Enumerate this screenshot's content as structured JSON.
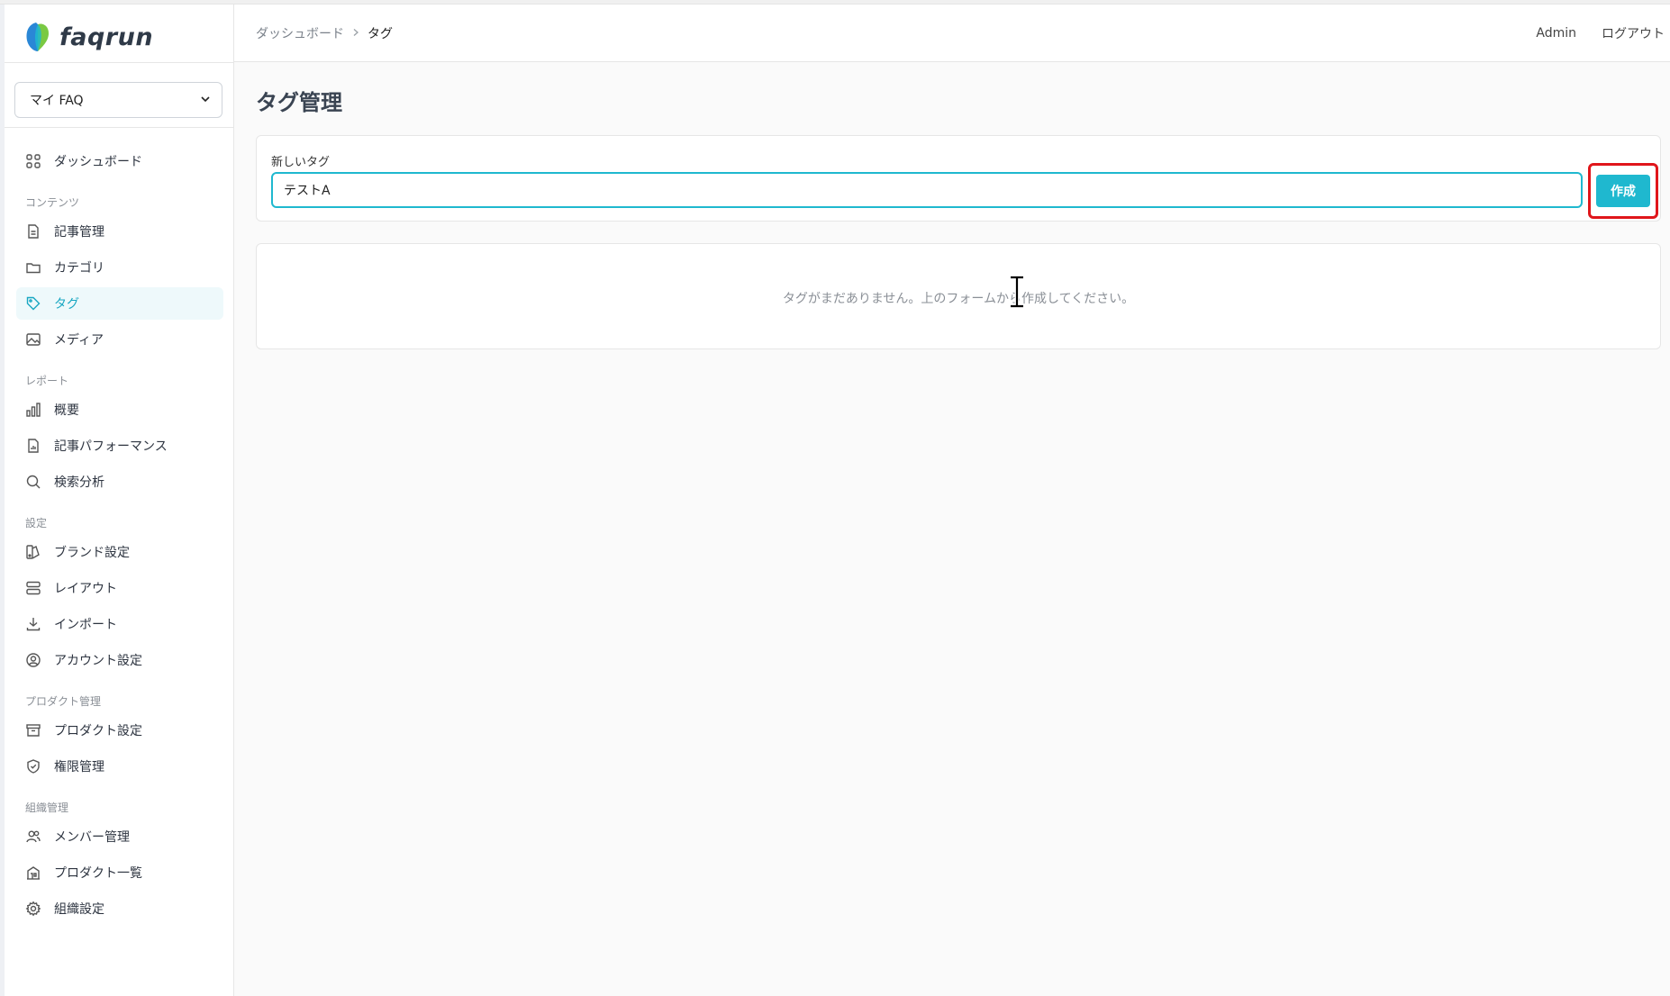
{
  "brand": {
    "name": "faqrun",
    "accent": "#1fb8cf",
    "highlight": "#e0161b"
  },
  "sidebar": {
    "product_select": {
      "value": "マイ FAQ"
    },
    "top_items": [
      {
        "label": "ダッシュボード",
        "icon": "grid-icon"
      }
    ],
    "sections": [
      {
        "label": "コンテンツ",
        "items": [
          {
            "label": "記事管理",
            "icon": "document-icon"
          },
          {
            "label": "カテゴリ",
            "icon": "folder-icon"
          },
          {
            "label": "タグ",
            "icon": "tag-icon",
            "active": true
          },
          {
            "label": "メディア",
            "icon": "image-icon"
          }
        ]
      },
      {
        "label": "レポート",
        "items": [
          {
            "label": "概要",
            "icon": "bar-chart-icon"
          },
          {
            "label": "記事パフォーマンス",
            "icon": "doc-chart-icon"
          },
          {
            "label": "検索分析",
            "icon": "search-icon"
          }
        ]
      },
      {
        "label": "設定",
        "items": [
          {
            "label": "ブランド設定",
            "icon": "palette-icon"
          },
          {
            "label": "レイアウト",
            "icon": "layout-icon"
          },
          {
            "label": "インポート",
            "icon": "download-icon"
          },
          {
            "label": "アカウント設定",
            "icon": "user-circle-icon"
          }
        ]
      },
      {
        "label": "プロダクト管理",
        "items": [
          {
            "label": "プロダクト設定",
            "icon": "archive-icon"
          },
          {
            "label": "権限管理",
            "icon": "shield-icon"
          }
        ]
      },
      {
        "label": "組織管理",
        "items": [
          {
            "label": "メンバー管理",
            "icon": "users-icon"
          },
          {
            "label": "プロダクト一覧",
            "icon": "building-icon"
          },
          {
            "label": "組織設定",
            "icon": "gear-icon"
          }
        ]
      }
    ]
  },
  "header": {
    "breadcrumb": [
      "ダッシュボード",
      "タグ"
    ],
    "user": "Admin",
    "logout": "ログアウト"
  },
  "main": {
    "title": "タグ管理",
    "form": {
      "label": "新しいタグ",
      "input_value": "テストA",
      "submit_label": "作成"
    },
    "empty_message": "タグがまだありません。上のフォームから作成してください。"
  }
}
